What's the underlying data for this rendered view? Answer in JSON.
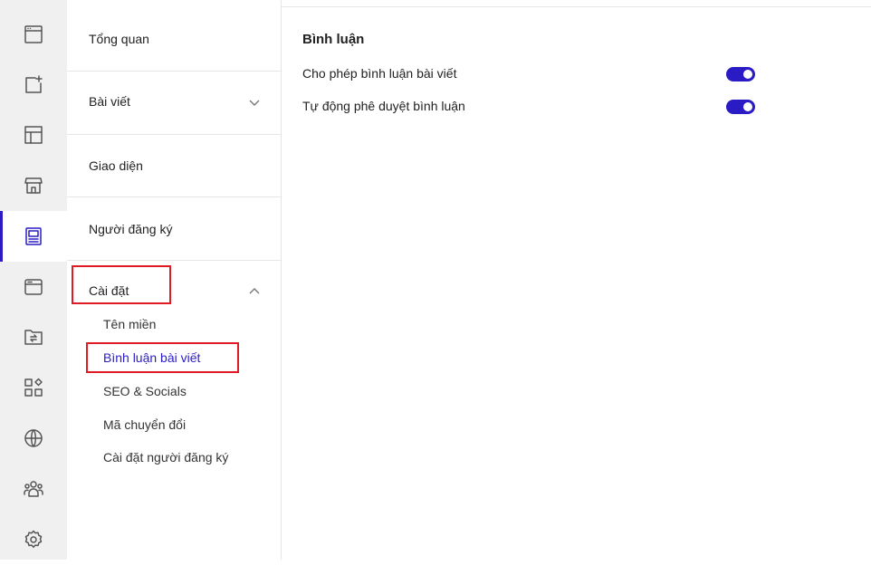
{
  "rail": {
    "items": [
      {
        "icon": "browser-window-icon"
      },
      {
        "icon": "add-sparkle-icon"
      },
      {
        "icon": "layout-icon"
      },
      {
        "icon": "store-icon"
      },
      {
        "icon": "blog-post-icon",
        "active": true
      },
      {
        "icon": "web-app-icon"
      },
      {
        "icon": "folder-sync-icon"
      },
      {
        "icon": "apps-grid-icon"
      },
      {
        "icon": "globe-icon"
      },
      {
        "icon": "users-group-icon"
      },
      {
        "icon": "settings-gear-icon"
      }
    ]
  },
  "nav": {
    "items": [
      {
        "label": "Tổng quan"
      },
      {
        "label": "Bài viết",
        "chevron": "chevron-down-icon"
      },
      {
        "label": "Giao diện"
      },
      {
        "label": "Người đăng ký"
      },
      {
        "label": "Cài đặt",
        "chevron": "chevron-up-icon",
        "expanded": true
      }
    ],
    "settings_sub": [
      {
        "label": "Tên miền"
      },
      {
        "label": "Bình luận bài viết",
        "active": true
      },
      {
        "label": "SEO & Socials"
      },
      {
        "label": "Mã chuyển đổi"
      },
      {
        "label": "Cài đặt người đăng ký"
      }
    ]
  },
  "main": {
    "title": "Bình luận",
    "settings": [
      {
        "label": "Cho phép bình luận bài viết",
        "enabled": true
      },
      {
        "label": "Tự động phê duyệt bình luận",
        "enabled": true
      }
    ]
  },
  "colors": {
    "accent": "#2a1bc4",
    "highlight": "#e01b24",
    "rail_bg": "#f0f0f0"
  }
}
